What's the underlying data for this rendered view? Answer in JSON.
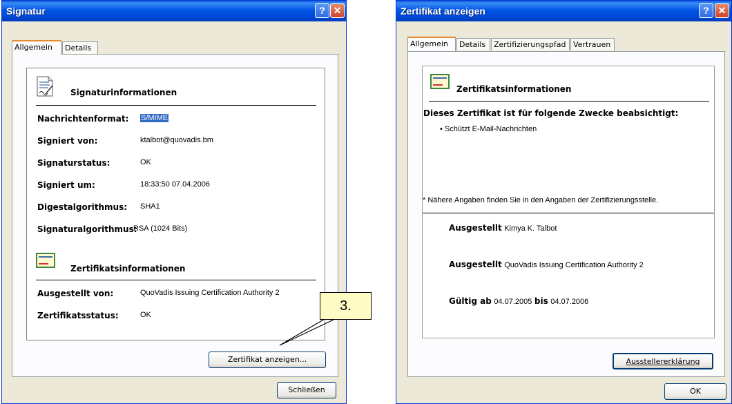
{
  "signatur": {
    "title": "Signatur",
    "tabs": [
      "Allgemein",
      "Details"
    ],
    "section1": "Signaturinformationen",
    "fields": [
      {
        "label": "Nachrichtenformat:",
        "value": "S/MIME"
      },
      {
        "label": "Signiert von:",
        "value": "ktalbot@quovadis.bm"
      },
      {
        "label": "Signaturstatus:",
        "value": "OK"
      },
      {
        "label": "Signiert um:",
        "value": "18:33:50 07.04.2006"
      },
      {
        "label": "Digestalgorithmus:",
        "value": "SHA1"
      },
      {
        "label": "Signaturalgorithmus:",
        "value": "RSA (1024 Bits)"
      }
    ],
    "section2": "Zertifikatsinformationen",
    "cert_fields": [
      {
        "label": "Ausgestellt von:",
        "value": "QuoVadis Issuing Certification Authority 2"
      },
      {
        "label": "Zertifikatsstatus:",
        "value": "OK"
      }
    ],
    "view_cert_button": "Zertifikat anzeigen...",
    "close_button": "Schließen"
  },
  "callout": "3.",
  "zertifikat": {
    "title": "Zertifikat anzeigen",
    "tabs": [
      "Allgemein",
      "Details",
      "Zertifizierungspfad",
      "Vertrauen"
    ],
    "section": "Zertifikatsinformationen",
    "purpose_heading": "Dieses Zertifikat ist für folgende Zwecke beabsichtigt:",
    "purposes": [
      "Schützt E-Mail-Nachrichten"
    ],
    "footnote": "* Nähere Angaben finden Sie in den Angaben der Zertifizierungsstelle.",
    "issued_to_label": "Ausgestellt",
    "issued_to": "Kimya K. Talbot",
    "issued_by_label": "Ausgestellt",
    "issued_by": "QuoVadis Issuing Certification Authority 2",
    "valid_from_label": "Gültig ab",
    "valid_from": "04.07.2005",
    "valid_to_label": "bis",
    "valid_to": "04.07.2006",
    "issuer_statement_button": "Ausstellererklärung",
    "ok_button": "OK"
  },
  "colors": {
    "titlebar": "#0055e5",
    "dialog_bg": "#ece9d8",
    "tab_accent": "#e68b2c",
    "callout_bg": "#fffbc4"
  }
}
